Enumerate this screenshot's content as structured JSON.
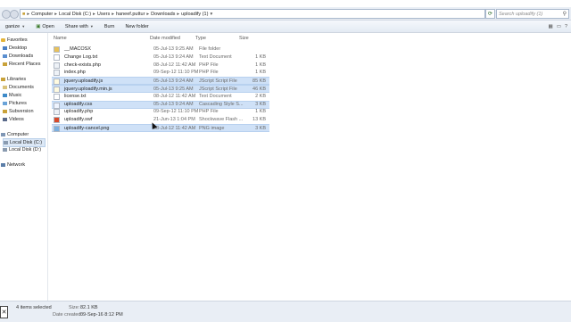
{
  "address_bar": {
    "crumbs": [
      "Computer",
      "Local Disk (C:)",
      "Users",
      "haneef.puttur",
      "Downloads",
      "uploadify (1)"
    ],
    "search_placeholder": "Search uploadify (1)"
  },
  "toolbar": {
    "organize": "ganize",
    "open": "Open",
    "share": "Share with",
    "burn": "Burn",
    "new_folder": "New folder"
  },
  "sidebar": {
    "favorites": "Favorites",
    "desktop": "Desktop",
    "downloads": "Downloads",
    "recent": "Recent Places",
    "libraries": "Libraries",
    "documents": "Documents",
    "music": "Music",
    "pictures": "Pictures",
    "subversion": "Subversion",
    "videos": "Videos",
    "computer": "Computer",
    "disk_c": "Local Disk (C:)",
    "disk_d": "Local Disk (D:)",
    "network": "Network"
  },
  "columns": {
    "name": "Name",
    "date": "Date modified",
    "type": "Type",
    "size": "Size"
  },
  "files": [
    {
      "name": "__MACOSX",
      "date": "05-Jul-13 9:25 AM",
      "type": "File folder",
      "size": ""
    },
    {
      "name": "Change Log.txt",
      "date": "05-Jul-13 9:24 AM",
      "type": "Text Document",
      "size": "1 KB"
    },
    {
      "name": "check-exists.php",
      "date": "08-Jul-12 11:42 AM",
      "type": "PHP File",
      "size": "1 KB"
    },
    {
      "name": "index.php",
      "date": "09-Sep-12 11:10 PM",
      "type": "PHP File",
      "size": "1 KB"
    },
    {
      "name": "jquery.uploadify.js",
      "date": "05-Jul-13 9:24 AM",
      "type": "JScript Script File",
      "size": "85 KB"
    },
    {
      "name": "jquery.uploadify.min.js",
      "date": "05-Jul-13 9:25 AM",
      "type": "JScript Script File",
      "size": "46 KB"
    },
    {
      "name": "license.txt",
      "date": "08-Jul-12 11:42 AM",
      "type": "Text Document",
      "size": "2 KB"
    },
    {
      "name": "uploadify.css",
      "date": "05-Jul-13 9:24 AM",
      "type": "Cascading Style S...",
      "size": "3 KB"
    },
    {
      "name": "uploadify.php",
      "date": "09-Sep-12 11:10 PM",
      "type": "PHP File",
      "size": "1 KB"
    },
    {
      "name": "uploadify.swf",
      "date": "21-Jun-13 1:04 PM",
      "type": "Shockwave Flash ...",
      "size": "13 KB"
    },
    {
      "name": "uploadify-cancel.png",
      "date": "08-Jul-12 11:42 AM",
      "type": "PNG image",
      "size": "3 KB"
    }
  ],
  "status": {
    "selected": "4 items selected",
    "size_label": "Size:",
    "size_value": "82.1 KB",
    "created_label": "Date created:",
    "created_value": "09-Sep-16 8:12 PM"
  },
  "colors": {
    "selection": "#cfe1f7",
    "folder": "#e8c15a"
  }
}
